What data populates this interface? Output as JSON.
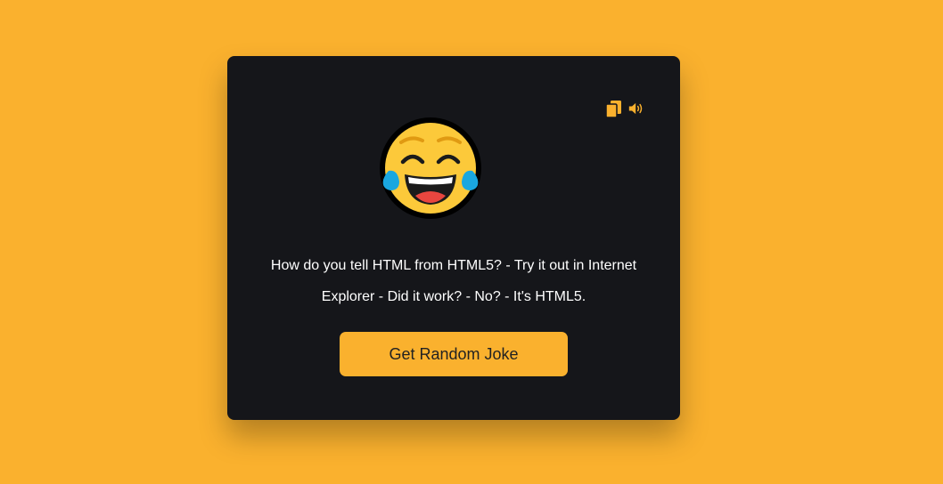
{
  "colors": {
    "background": "#fab12e",
    "card": "#15161a",
    "accent": "#fab12e",
    "text": "#ffffff"
  },
  "toolbar": {
    "icons": [
      "copy-icon",
      "speaker-icon"
    ]
  },
  "emoji": {
    "name": "face-with-tears-of-joy-icon"
  },
  "joke": {
    "text": "How do you tell HTML from HTML5? - Try it out in Internet Explorer - Did it work? - No? - It's HTML5."
  },
  "button": {
    "label": "Get Random Joke"
  }
}
